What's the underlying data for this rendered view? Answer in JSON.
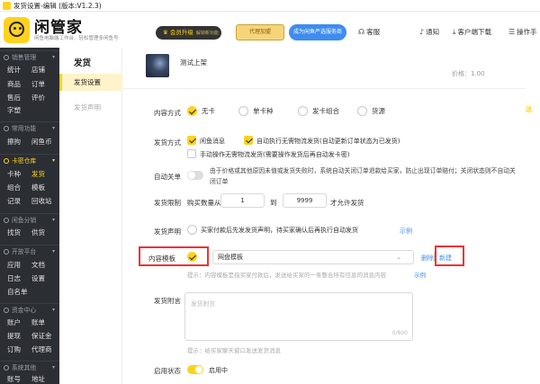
{
  "window": {
    "title": "发货设置-编辑 (版本:V1.2.3)"
  },
  "header": {
    "brand": "闲管家",
    "brand_sub": "闲鱼电脑端工作台、轻松管理多闲鱼号",
    "vip_label": "会员升级",
    "vip_sub": "解锁新功能",
    "promo1": "代理加盟",
    "promo2": "成为闲鱼严选服务商",
    "nav": [
      {
        "icon": "headset-icon",
        "glyph": "☊",
        "label": "客服"
      },
      {
        "icon": "bell-icon",
        "glyph": "♪",
        "label": "通知"
      },
      {
        "icon": "download-icon",
        "glyph": "⤓",
        "label": "客户端下载"
      },
      {
        "icon": "manual-icon",
        "glyph": "☰",
        "label": "操作手"
      }
    ]
  },
  "sidebar": {
    "groups": [
      {
        "label": "销售管理",
        "icon": "sales-icon",
        "items": [
          [
            "统计",
            "店铺"
          ],
          [
            "商品",
            "订单"
          ],
          [
            "售后",
            "评价"
          ],
          [
            "字塑"
          ]
        ]
      },
      {
        "label": "常用功能",
        "icon": "tools-icon",
        "items": [
          [
            "擦拘",
            "闲鱼币"
          ]
        ]
      },
      {
        "label": "卡密仓库",
        "icon": "card-icon",
        "active": true,
        "items": [
          [
            "卡种",
            "发货"
          ],
          [
            "组合",
            "模板"
          ],
          [
            "记录",
            "回收站"
          ]
        ]
      },
      {
        "label": "闲鱼分销",
        "icon": "distribution-icon",
        "items": [
          [
            "找货",
            "供货"
          ]
        ]
      },
      {
        "label": "开放平台",
        "icon": "platform-icon",
        "items": [
          [
            "应用",
            "文档"
          ],
          [
            "日志",
            "设置"
          ],
          [
            "自名单"
          ]
        ]
      },
      {
        "label": "资金中心",
        "icon": "wallet-icon",
        "items": [
          [
            "账户",
            "账单"
          ],
          [
            "提现",
            "保证金"
          ],
          [
            "订购",
            "代理商"
          ]
        ]
      },
      {
        "label": "系统其他",
        "icon": "system-icon",
        "items": [
          [
            "账号",
            "地址"
          ]
        ]
      }
    ]
  },
  "subnav": {
    "title": "发货",
    "items": [
      "发货设置",
      "发货声明"
    ]
  },
  "product": {
    "title": "测试上架",
    "price": "价格：1.00"
  },
  "rightstrip": "活",
  "form": {
    "content_type": {
      "label": "内容方式",
      "options": [
        "无卡",
        "单卡种",
        "发卡组合",
        "货源"
      ],
      "selected": 0
    },
    "ship_method": {
      "label": "发货方式",
      "opt1": "闲鱼消息",
      "opt2": "自动执行无需物流发货(自动更新订单状态为已发货)",
      "opt3": "手动操作无需物流发货(需要操作发货后再自动发卡密)"
    },
    "auto_close": {
      "label": "自动关单",
      "text": "由于价格或其他原因未值或发货失败时，系统自动关闭订单退款给买家，防止出现订单赔付；关闭状态则不自动关闭订单"
    },
    "limit": {
      "label": "发货限制",
      "prefix": "购买数量从",
      "min": "1",
      "to": "到",
      "max": "9999",
      "suffix": "才允许发货"
    },
    "statement": {
      "label": "发货声明",
      "text": "买家付款后先发发货声明，待买家确认后再执行自动发货",
      "example": "示例"
    },
    "template": {
      "label": "内容模板",
      "value": "网盘模板",
      "delete": "删除",
      "new": "新建",
      "hint": "提示：内容模板是指买家付款后，发送给买家的一条整合所有信息的消息内容",
      "example": "示例"
    },
    "attach": {
      "label": "发货附言",
      "placeholder": "发货附言",
      "counter": "0/800",
      "hint": "提示：给买家聊天窗口发送发货消息"
    },
    "enable": {
      "label": "启用状态",
      "value": "启用中"
    }
  }
}
